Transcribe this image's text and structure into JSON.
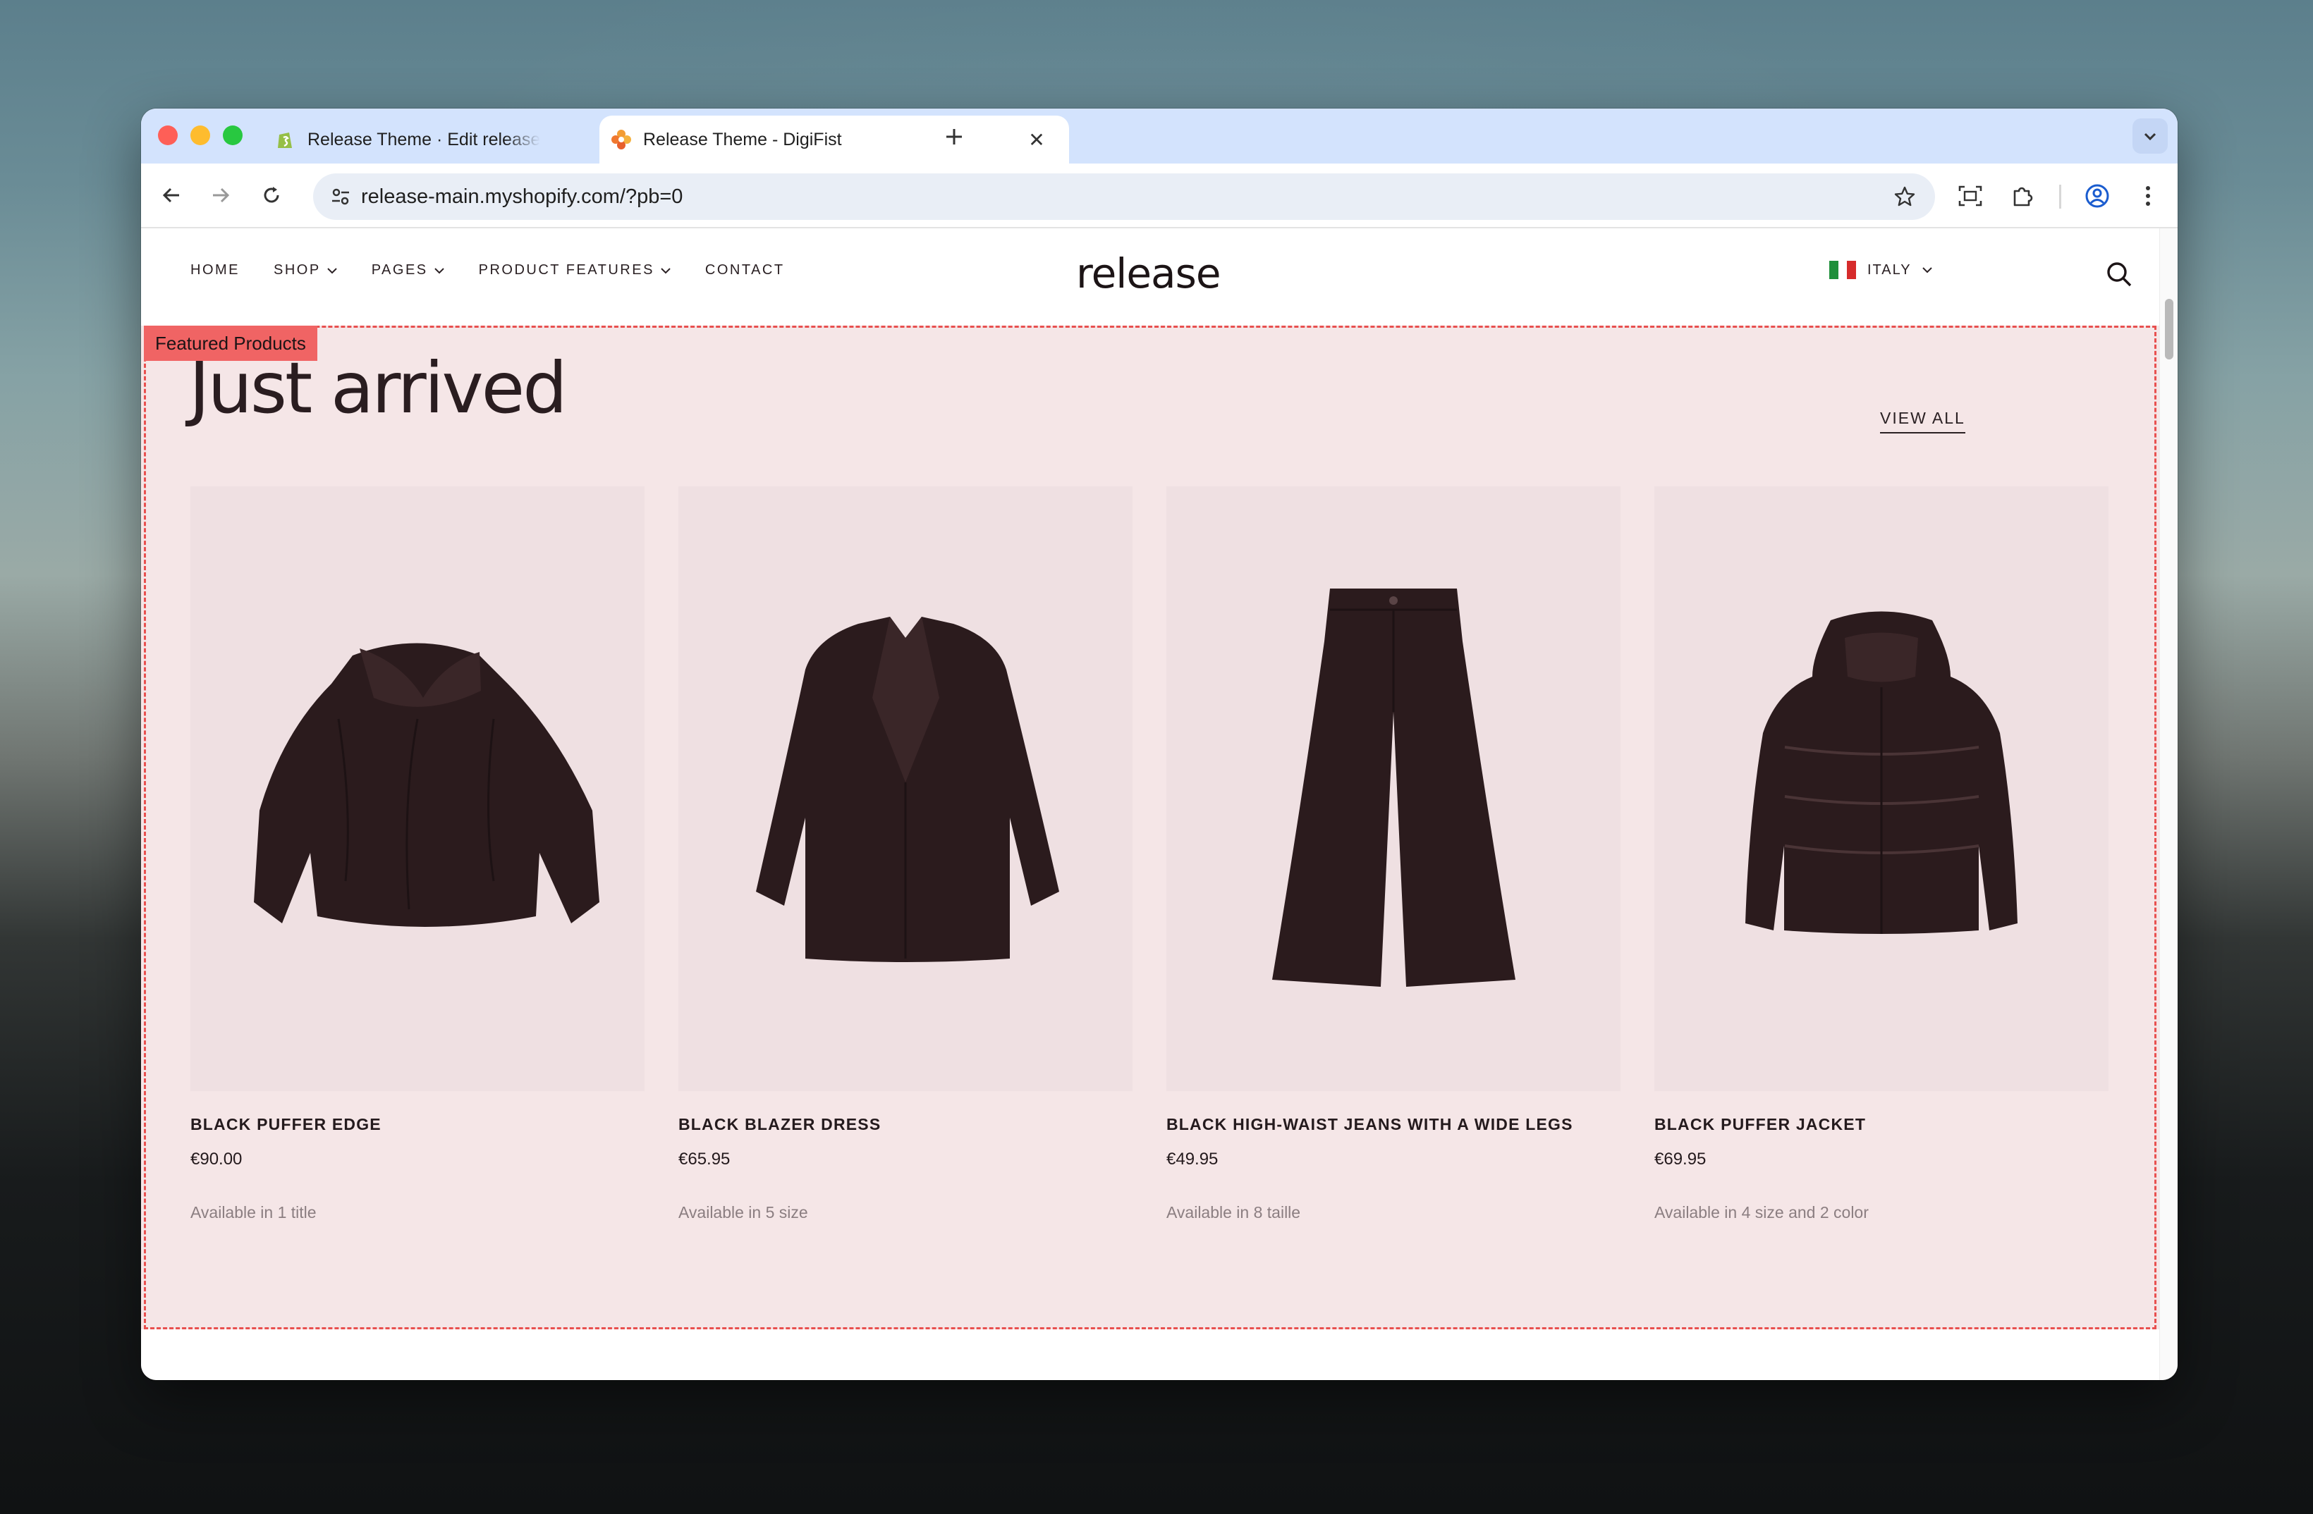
{
  "browser": {
    "tabs": [
      {
        "title": "Release Theme · Edit release",
        "favicon": "shopify-icon"
      },
      {
        "title": "Release Theme - DigiFist",
        "favicon": "digifist-icon",
        "active": true
      }
    ],
    "url": "release-main.myshopify.com/?pb=0"
  },
  "store": {
    "nav": [
      "HOME",
      "SHOP",
      "PAGES",
      "PRODUCT FEATURES",
      "CONTACT"
    ],
    "logo": "release",
    "locale": "ITALY"
  },
  "section": {
    "tag": "Featured Products",
    "title": "Just arrived",
    "view_all": "VIEW ALL"
  },
  "products": [
    {
      "name": "BLACK PUFFER EDGE",
      "price": "€90.00",
      "availability": "Available in 1 title"
    },
    {
      "name": "BLACK BLAZER DRESS",
      "price": "€65.95",
      "availability": "Available in 5 size"
    },
    {
      "name": "BLACK HIGH-WAIST JEANS WITH A WIDE LEGS",
      "price": "€49.95",
      "availability": "Available in 8 taille"
    },
    {
      "name": "BLACK PUFFER JACKET",
      "price": "€69.95",
      "availability": "Available in 4 size and 2 color"
    }
  ],
  "colors": {
    "section_bg": "#f5e6e7",
    "card_bg": "#efe0e2",
    "outline": "#e8504f",
    "garment": "#2b1b1d"
  }
}
